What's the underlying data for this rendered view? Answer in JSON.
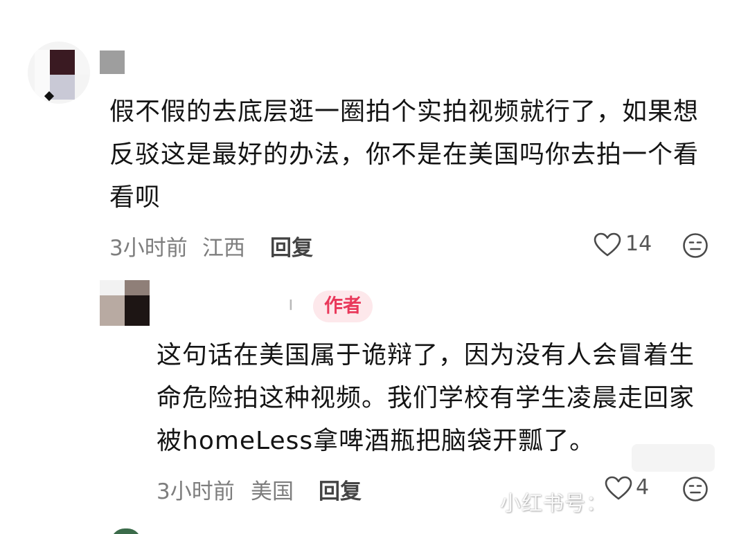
{
  "comments": [
    {
      "text": "假不假的去底层逛一圈拍个实拍视频就行了，如果想反驳这是最好的办法，你不是在美国吗你去拍一个看看呗",
      "time": "3小时前",
      "location": "江西",
      "reply_label": "回复",
      "likes": "14"
    }
  ],
  "reply": {
    "name_fragment": "ı",
    "author_badge": "作者",
    "text": "这句话在美国属于诡辩了，因为没有人会冒着生命危险拍这种视频。我们学校有学生凌晨走回家被homeLess拿啤酒瓶把脑袋开瓢了。",
    "time": "3小时前",
    "location": "美国",
    "reply_label": "回复",
    "likes": "4"
  },
  "watermark": "小红书号：",
  "colors": {
    "badge_bg": "#fde8eb",
    "badge_text": "#e9385a",
    "meta_text": "#7d7d7d"
  },
  "icons": [
    "heart-outline-icon",
    "emoji-face-icon"
  ]
}
